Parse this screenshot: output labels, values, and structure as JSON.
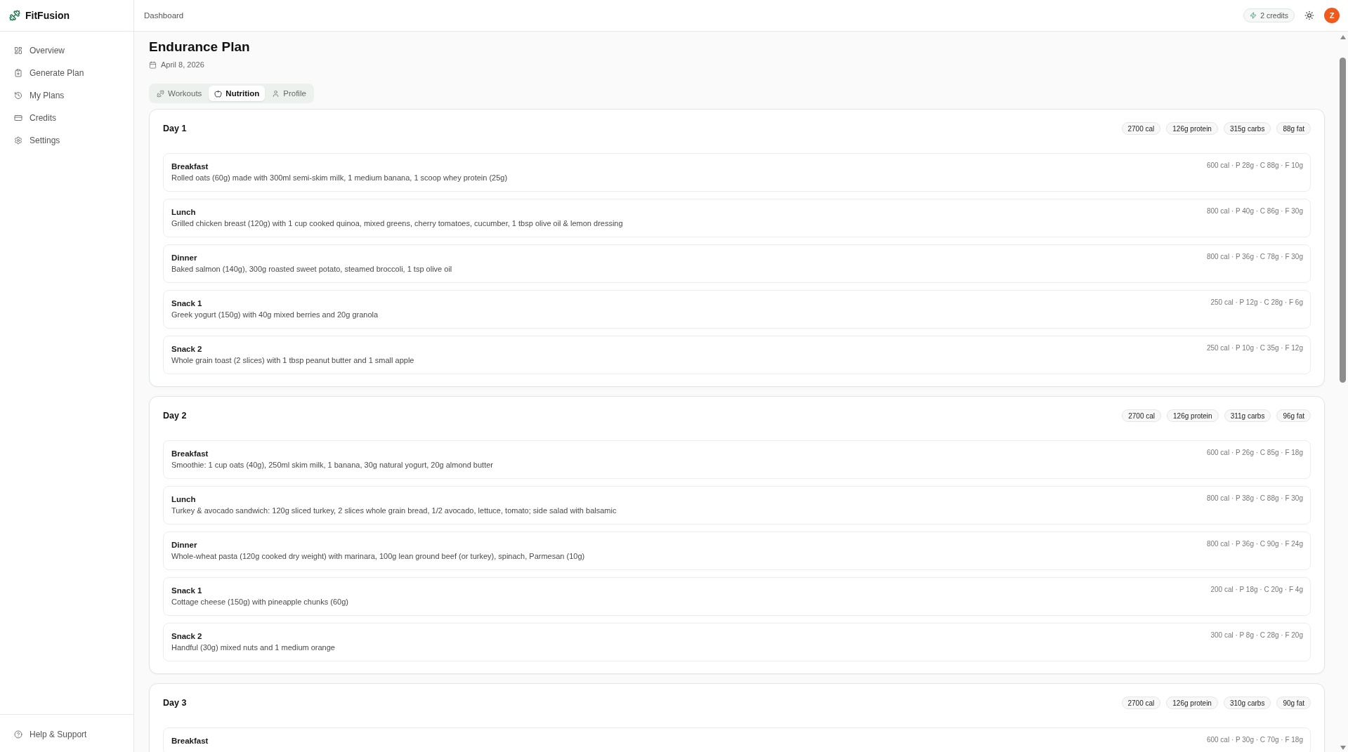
{
  "brand": {
    "name": "FitFusion"
  },
  "sidebar": {
    "items": [
      {
        "label": "Overview",
        "selected": false
      },
      {
        "label": "Generate Plan",
        "selected": false
      },
      {
        "label": "My Plans",
        "selected": false
      },
      {
        "label": "Credits",
        "selected": false
      },
      {
        "label": "Settings",
        "selected": false
      }
    ],
    "footer_item": {
      "label": "Help & Support"
    }
  },
  "header": {
    "breadcrumb": "Dashboard",
    "credits": "2 credits",
    "avatar_initial": "Z"
  },
  "plan": {
    "title": "Endurance Plan",
    "date": "April 8, 2026",
    "tabs": [
      {
        "label": "Workouts",
        "selected": false
      },
      {
        "label": "Nutrition",
        "selected": true
      },
      {
        "label": "Profile",
        "selected": false
      }
    ],
    "days": [
      {
        "title": "Day 1",
        "totals": [
          "2700 cal",
          "126g protein",
          "315g carbs",
          "88g fat"
        ],
        "meals": [
          {
            "name": "Breakfast",
            "description": "Rolled oats (60g) made with 300ml semi-skim milk, 1 medium banana, 1 scoop whey protein (25g)",
            "macros": "600 cal · P 28g · C 88g · F 10g"
          },
          {
            "name": "Lunch",
            "description": "Grilled chicken breast (120g) with 1 cup cooked quinoa, mixed greens, cherry tomatoes, cucumber, 1 tbsp olive oil & lemon dressing",
            "macros": "800 cal · P 40g · C 86g · F 30g"
          },
          {
            "name": "Dinner",
            "description": "Baked salmon (140g), 300g roasted sweet potato, steamed broccoli, 1 tsp olive oil",
            "macros": "800 cal · P 36g · C 78g · F 30g"
          },
          {
            "name": "Snack 1",
            "description": "Greek yogurt (150g) with 40g mixed berries and 20g granola",
            "macros": "250 cal · P 12g · C 28g · F 6g"
          },
          {
            "name": "Snack 2",
            "description": "Whole grain toast (2 slices) with 1 tbsp peanut butter and 1 small apple",
            "macros": "250 cal · P 10g · C 35g · F 12g"
          }
        ]
      },
      {
        "title": "Day 2",
        "totals": [
          "2700 cal",
          "126g protein",
          "311g carbs",
          "96g fat"
        ],
        "meals": [
          {
            "name": "Breakfast",
            "description": "Smoothie: 1 cup oats (40g), 250ml skim milk, 1 banana, 30g natural yogurt, 20g almond butter",
            "macros": "600 cal · P 26g · C 85g · F 18g"
          },
          {
            "name": "Lunch",
            "description": "Turkey & avocado sandwich: 120g sliced turkey, 2 slices whole grain bread, 1/2 avocado, lettuce, tomato; side salad with balsamic",
            "macros": "800 cal · P 38g · C 88g · F 30g"
          },
          {
            "name": "Dinner",
            "description": "Whole-wheat pasta (120g cooked dry weight) with marinara, 100g lean ground beef (or turkey), spinach, Parmesan (10g)",
            "macros": "800 cal · P 36g · C 90g · F 24g"
          },
          {
            "name": "Snack 1",
            "description": "Cottage cheese (150g) with pineapple chunks (60g)",
            "macros": "200 cal · P 18g · C 20g · F 4g"
          },
          {
            "name": "Snack 2",
            "description": "Handful (30g) mixed nuts and 1 medium orange",
            "macros": "300 cal · P 8g · C 28g · F 20g"
          }
        ]
      },
      {
        "title": "Day 3",
        "totals": [
          "2700 cal",
          "126g protein",
          "310g carbs",
          "90g fat"
        ],
        "meals": [
          {
            "name": "Breakfast",
            "macros": "600 cal · P 30g · C 70g · F 18g"
          }
        ]
      }
    ]
  }
}
